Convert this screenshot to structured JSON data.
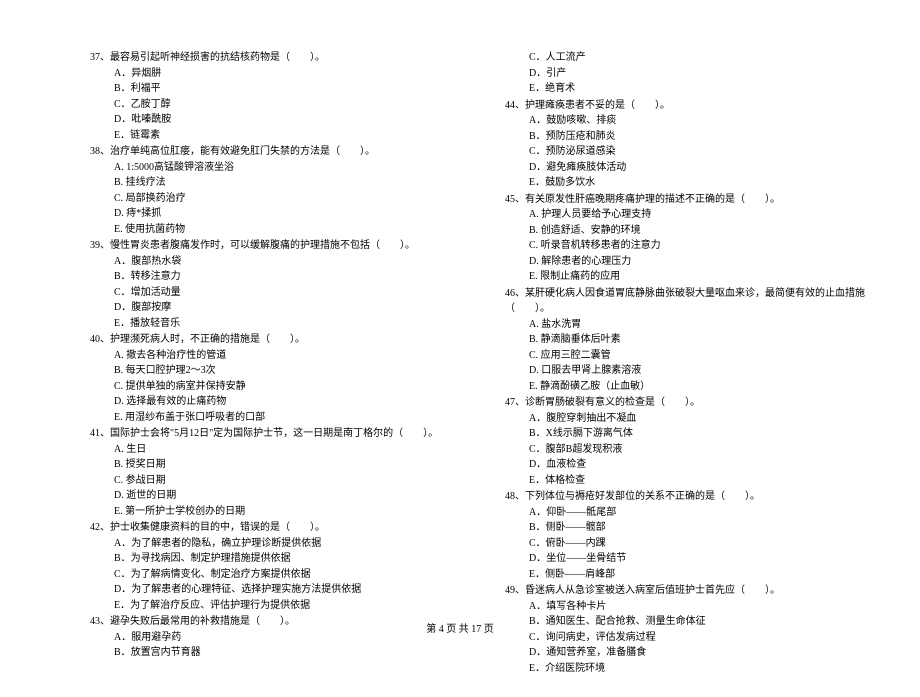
{
  "footer": "第 4 页 共 17 页",
  "left": [
    {
      "q": "37、最容易引起听神经损害的抗结核药物是（　　）。",
      "opts": [
        "A．异烟肼",
        "B．利福平",
        "C．乙胺丁醇",
        "D．吡嗪酰胺",
        "E．链霉素"
      ]
    },
    {
      "q": "38、治疗单纯高位肛瘘，能有效避免肛门失禁的方法是（　　）。",
      "opts": [
        "A. 1:5000高锰酸钾溶液坐浴",
        "B. 挂线疗法",
        "C. 局部换药治疗",
        "D. 痔*揉抓",
        "E. 使用抗菌药物"
      ]
    },
    {
      "q": "39、慢性胃炎患者腹痛发作时，可以缓解腹痛的护理措施不包括（　　）。",
      "opts": [
        "A．腹部热水袋",
        "B．转移注意力",
        "C．增加活动量",
        "D．腹部按摩",
        "E．播放轻音乐"
      ]
    },
    {
      "q": "40、护理濒死病人时，不正确的措施是（　　）。",
      "opts": [
        "A. 撤去各种治疗性的管道",
        "B. 每天口腔护理2～3次",
        "C. 提供单独的病室并保持安静",
        "D. 选择最有效的止痛药物",
        "E. 用湿纱布盖于张口呼吸者的口部"
      ]
    },
    {
      "q": "41、国际护士会将\"5月12日\"定为国际护士节，这一日期是南丁格尔的（　　）。",
      "opts": [
        "A. 生日",
        "B. 授奖日期",
        "C. 参战日期",
        "D. 逝世的日期",
        "E. 第一所护士学校创办的日期"
      ]
    },
    {
      "q": "42、护士收集健康资料的目的中，错误的是（　　）。",
      "opts": [
        "A．为了解患者的隐私，确立护理诊断提供依据",
        "B．为寻找病因、制定护理措施提供依据",
        "C．为了解病情变化、制定治疗方案提供依据",
        "D．为了解患者的心理特征、选择护理实施方法提供依据",
        "E．为了解治疗反应、评估护理行为提供依据"
      ]
    },
    {
      "q": "43、避孕失败后最常用的补救措施是（　　）。",
      "opts": [
        "A．服用避孕药",
        "B．放置宫内节育器"
      ]
    }
  ],
  "right": [
    {
      "q": "",
      "opts": [
        "C．人工流产",
        "D．引产",
        "E．绝育术"
      ]
    },
    {
      "q": "44、护理瘫痪患者不妥的是（　　）。",
      "opts": [
        "A．鼓励咳嗽、排痰",
        "B．预防压疮和肺炎",
        "C．预防泌尿道感染",
        "D．避免瘫痪肢体活动",
        "E．鼓励多饮水"
      ]
    },
    {
      "q": "45、有关原发性肝癌晚期疼痛护理的描述不正确的是（　　）。",
      "opts": [
        "A. 护理人员要给予心理支持",
        "B. 创造舒适、安静的环境",
        "C. 听录音机转移患者的注意力",
        "D. 解除患者的心理压力",
        "E. 限制止痛药的应用"
      ]
    },
    {
      "q": "46、某肝硬化病人因食道胃底静脉曲张破裂大量呕血来诊，最简便有效的止血措施（　　）。",
      "opts": [
        "A. 盐水洗胃",
        "B. 静滴脑垂体后叶素",
        "C. 应用三腔二囊管",
        "D. 口服去甲肾上腺素溶液",
        "E. 静滴酚磺乙胺（止血敏）"
      ]
    },
    {
      "q": "47、诊断胃肠破裂有意义的检查是（　　）。",
      "opts": [
        "A．腹腔穿刺抽出不凝血",
        "B．X线示膈下游离气体",
        "C．腹部B超发现积液",
        "D．血液检查",
        "E．体格检查"
      ]
    },
    {
      "q": "48、下列体位与褥疮好发部位的关系不正确的是（　　）。",
      "opts": [
        "A．仰卧——骶尾部",
        "B．侧卧——髋部",
        "C．俯卧——内踝",
        "D．坐位——坐骨结节",
        "E．侧卧——肩峰部"
      ]
    },
    {
      "q": "49、昏迷病人从急诊室被送入病室后值班护士首先应（　　）。",
      "opts": [
        "A．填写各种卡片",
        "B．通知医生、配合抢救、测量生命体征",
        "C．询问病史，评估发病过程",
        "D．通知营养室，准备膳食",
        "E．介绍医院环境"
      ]
    }
  ]
}
